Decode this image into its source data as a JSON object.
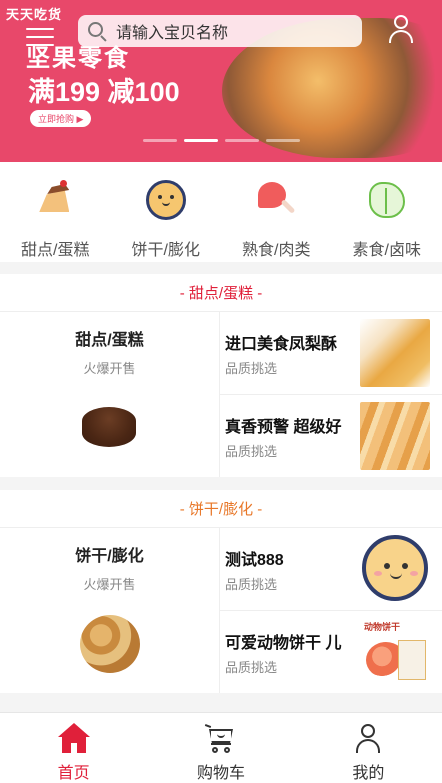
{
  "banner": {
    "logo_text": "天天吃货",
    "title": "坚果零食",
    "promo": "满199 减100",
    "button_text": "立即抢购 ▶",
    "slides": [
      false,
      true,
      false,
      false
    ],
    "bg_color": "#e8486a"
  },
  "search": {
    "placeholder": "请输入宝贝名称"
  },
  "categories": [
    {
      "label": "甜点/蛋糕",
      "icon": "cake-icon"
    },
    {
      "label": "饼干/膨化",
      "icon": "biscuit-icon"
    },
    {
      "label": "熟食/肉类",
      "icon": "drumstick-icon"
    },
    {
      "label": "素食/卤味",
      "icon": "vegetable-icon"
    }
  ],
  "sections": [
    {
      "title": "- 甜点/蛋糕 -",
      "title_color": "#e0203a",
      "left": {
        "name": "甜点/蛋糕",
        "sub": "火爆开售"
      },
      "items": [
        {
          "name": "进口美食凤梨酥",
          "sub": "品质挑选"
        },
        {
          "name": "真香预警 超级好",
          "sub": "品质挑选"
        }
      ]
    },
    {
      "title": "- 饼干/膨化 -",
      "title_color": "#e8782a",
      "left": {
        "name": "饼干/膨化",
        "sub": "火爆开售"
      },
      "items": [
        {
          "name": "测试888",
          "sub": "品质挑选"
        },
        {
          "name": "可爱动物饼干 儿",
          "sub": "品质挑选",
          "image_text": "动物饼干"
        }
      ]
    }
  ],
  "tabbar": {
    "tabs": [
      {
        "label": "首页",
        "icon": "home-icon",
        "active": true
      },
      {
        "label": "购物车",
        "icon": "cart-icon",
        "active": false
      },
      {
        "label": "我的",
        "icon": "user-icon",
        "active": false
      }
    ],
    "active_color": "#e0203a"
  }
}
